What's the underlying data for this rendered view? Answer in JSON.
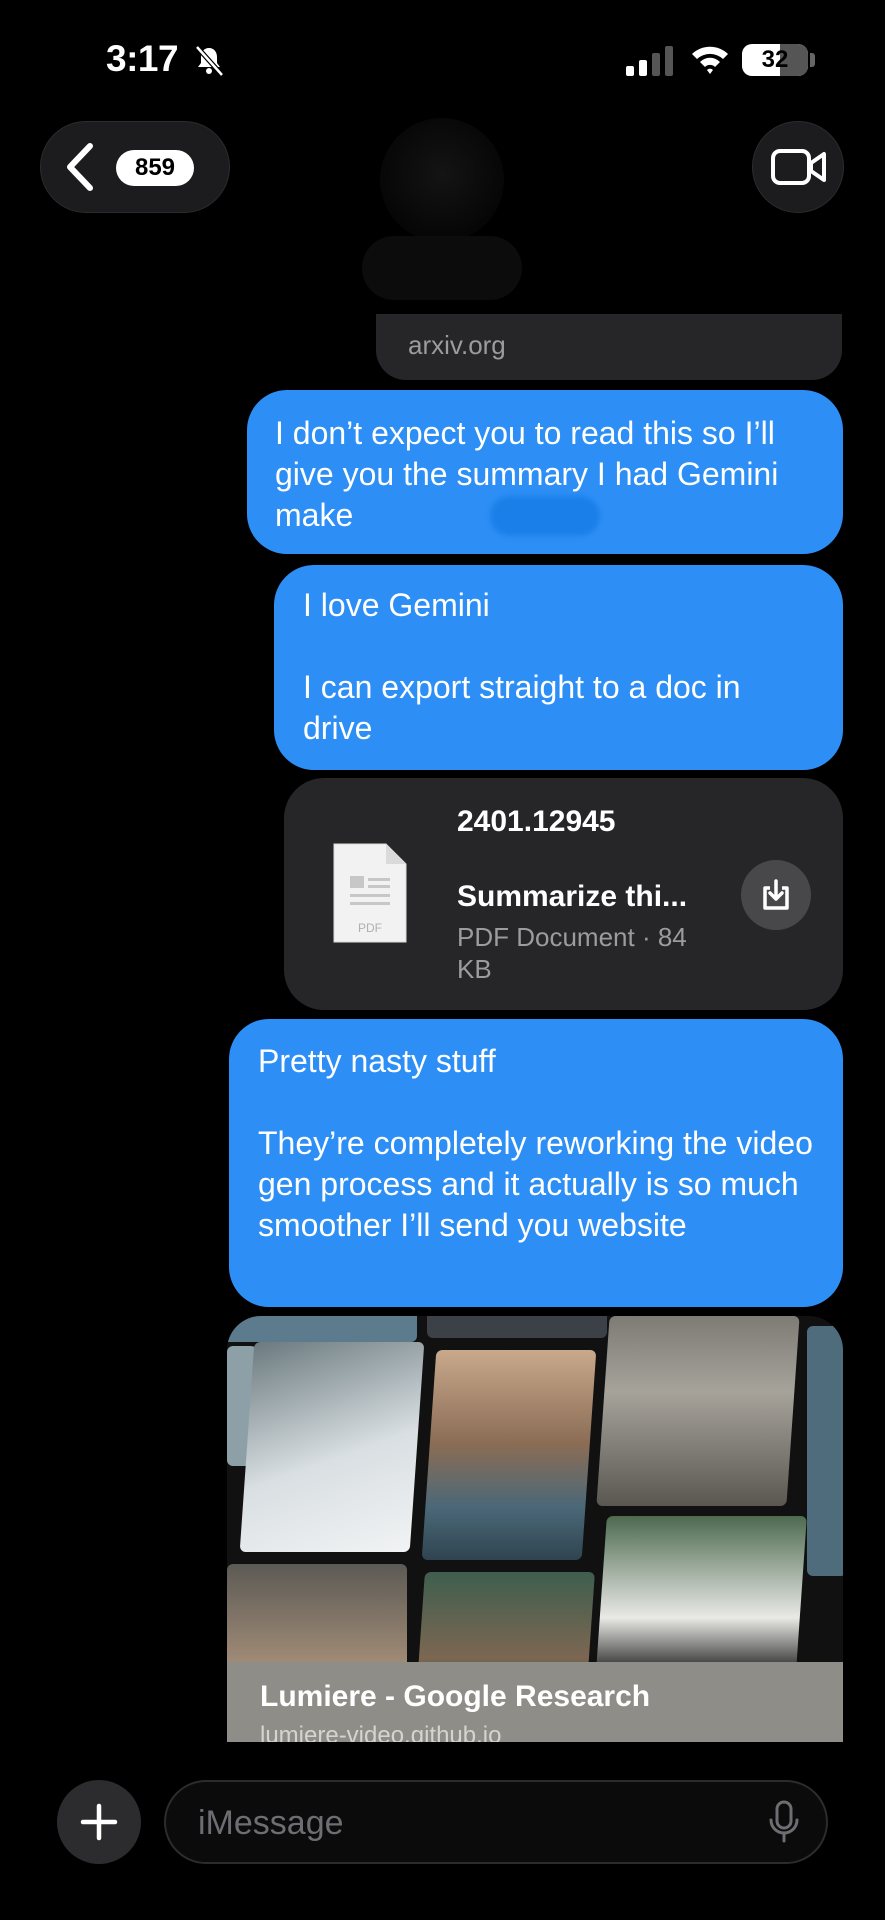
{
  "status_bar": {
    "time": "3:17",
    "battery": "32"
  },
  "header": {
    "unread_count": "859"
  },
  "messages": [
    {
      "type": "link_stub",
      "domain": "arxiv.org"
    },
    {
      "type": "text",
      "text": "I don’t expect you to read this so I’ll give you the summary I had Gemini make"
    },
    {
      "type": "text",
      "text": "I love Gemini\n\nI can export straight to a doc in drive"
    },
    {
      "type": "file",
      "name": "2401.12945",
      "title": "Summarize thi...",
      "meta": "PDF Document · 84 KB",
      "icon_label": "PDF"
    },
    {
      "type": "text",
      "text": "Pretty nasty stuff\n\nThey’re completely reworking the video gen process and it actually is so much smoother I’ll send you website"
    },
    {
      "type": "link_preview",
      "title": "Lumiere - Google Research",
      "domain": "lumiere-video.github.io"
    }
  ],
  "input": {
    "placeholder": "iMessage"
  },
  "colors": {
    "bubble_blue": "#2d8ff6",
    "card_gray": "#262628",
    "background": "#000000"
  },
  "icons": [
    "bell-slash-icon",
    "signal-icon",
    "wifi-icon",
    "battery-icon",
    "chevron-left-icon",
    "video-camera-icon",
    "pdf-document-icon",
    "download-icon",
    "plus-icon",
    "microphone-icon"
  ]
}
